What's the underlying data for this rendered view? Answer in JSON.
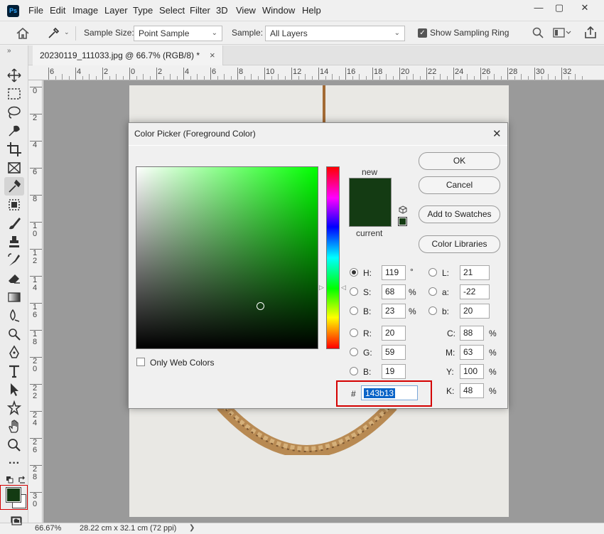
{
  "app": {
    "logo": "Ps"
  },
  "menu": [
    "File",
    "Edit",
    "Image",
    "Layer",
    "Type",
    "Select",
    "Filter",
    "3D",
    "View",
    "Window",
    "Help"
  ],
  "window_controls": {
    "minimize": "—",
    "restore": "▢",
    "close": "✕"
  },
  "options_bar": {
    "sample_size_label": "Sample Size:",
    "sample_size_value": "Point Sample",
    "sample_label": "Sample:",
    "sample_value": "All Layers",
    "show_ring_label": "Show Sampling Ring",
    "show_ring_checked": true
  },
  "document_tab": {
    "title": "20230119_111033.jpg @ 66.7% (RGB/8) *",
    "close": "×"
  },
  "ruler": {
    "h_ticks": [
      "6",
      "4",
      "2",
      "0",
      "2",
      "4",
      "6",
      "8",
      "10",
      "12",
      "14",
      "16",
      "18",
      "20",
      "22",
      "24",
      "26",
      "28",
      "30",
      "32"
    ],
    "v_ticks": [
      "0",
      "2",
      "4",
      "6",
      "8",
      "1\n0",
      "1\n2",
      "1\n4",
      "1\n6",
      "1\n8",
      "2\n0",
      "2\n2",
      "2\n4",
      "2\n6",
      "2\n8",
      "3\n0"
    ]
  },
  "status_bar": {
    "zoom": "66.67%",
    "doc_info": "28.22 cm x 32.1 cm (72 ppi)",
    "arrow": "❯"
  },
  "color_picker": {
    "title": "Color Picker (Foreground Color)",
    "close": "✕",
    "new_label": "new",
    "current_label": "current",
    "swatch_color": "#143b13",
    "buttons": {
      "ok": "OK",
      "cancel": "Cancel",
      "add_swatches": "Add to Swatches",
      "libraries": "Color Libraries"
    },
    "only_web_colors": "Only Web Colors",
    "hsb": {
      "h": {
        "label": "H:",
        "value": "119",
        "unit": "°"
      },
      "s": {
        "label": "S:",
        "value": "68",
        "unit": "%"
      },
      "b": {
        "label": "B:",
        "value": "23",
        "unit": "%"
      }
    },
    "rgb": {
      "r": {
        "label": "R:",
        "value": "20"
      },
      "g": {
        "label": "G:",
        "value": "59"
      },
      "b": {
        "label": "B:",
        "value": "19"
      }
    },
    "lab": {
      "l": {
        "label": "L:",
        "value": "21"
      },
      "a": {
        "label": "a:",
        "value": "-22"
      },
      "b": {
        "label": "b:",
        "value": "20"
      }
    },
    "cmyk": {
      "c": {
        "label": "C:",
        "value": "88",
        "unit": "%"
      },
      "m": {
        "label": "M:",
        "value": "63",
        "unit": "%"
      },
      "y": {
        "label": "Y:",
        "value": "100",
        "unit": "%"
      },
      "k": {
        "label": "K:",
        "value": "48",
        "unit": "%"
      }
    },
    "hex": {
      "label": "#",
      "value": "143b13"
    }
  },
  "colors": {
    "foreground": "#143b13",
    "background": "#ffffff",
    "highlight": "#d40000",
    "selection": "#0a64c8"
  }
}
